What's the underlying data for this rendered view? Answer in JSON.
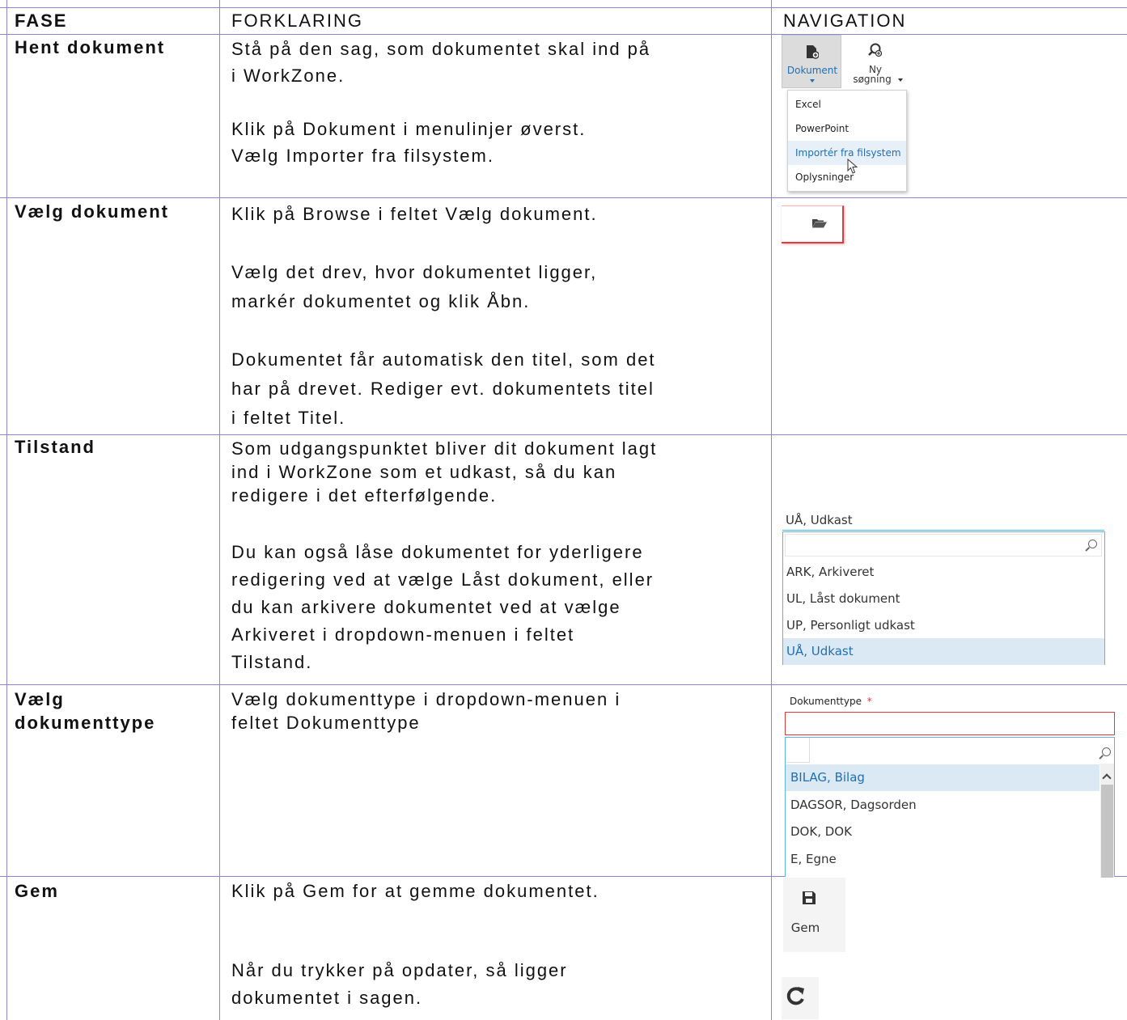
{
  "headers": {
    "fase": "FASE",
    "forklaring": "FORKLARING",
    "navigation": "NAVIGATION"
  },
  "rows": [
    {
      "fase": "Hent dokument",
      "text": [
        "Stå på den sag, som dokumentet skal ind på",
        "i WorkZone.",
        "",
        "Klik på Dokument i menulinjer øverst.",
        "Vælg Importer fra filsystem."
      ]
    },
    {
      "fase": "Vælg dokument",
      "text": [
        "Klik på Browse i feltet Vælg dokument.",
        "",
        "Vælg det drev, hvor dokumentet ligger,",
        "markér dokumentet og klik Åbn.",
        "",
        "Dokumentet får automatisk den titel, som det",
        "har på drevet. Rediger evt. dokumentets titel",
        "i feltet Titel."
      ]
    },
    {
      "fase": "Tilstand",
      "text_top": [
        "Som udgangspunktet bliver dit dokument lagt",
        "ind i WorkZone som et udkast, så du kan",
        "redigere i det efterfølgende."
      ],
      "text_bottom": [
        "Du kan også låse dokumentet for yderligere",
        "redigering ved at vælge Låst dokument, eller",
        "du kan arkivere dokumentet ved at vælge",
        "Arkiveret i dropdown-menuen i feltet",
        "Tilstand."
      ]
    },
    {
      "fase_lines": [
        "Vælg",
        "dokumenttype"
      ],
      "text": [
        "Vælg dokumenttype i dropdown-menuen i",
        "feltet Dokumenttype"
      ]
    },
    {
      "fase": "Gem",
      "text_top": [
        "Klik på Gem for at gemme dokumentet."
      ],
      "text_bottom": [
        "Når du trykker på opdater, så ligger",
        "dokumentet i sagen."
      ]
    }
  ],
  "nav": {
    "ribbon": {
      "dokument_label": "Dokument",
      "ny_label_1": "Ny",
      "ny_label_2": "søgning",
      "menu_items": [
        "Excel",
        "PowerPoint",
        "Importér fra filsystem",
        "Oplysninger"
      ],
      "highlighted_index": 2
    },
    "tilstand": {
      "current_value": "UÅ, Udkast",
      "options": [
        "ARK, Arkiveret",
        "UL, Låst dokument",
        "UP, Personligt udkast",
        "UÅ, Udkast"
      ],
      "selected_index": 3
    },
    "dokumenttype": {
      "label": "Dokumenttype",
      "required_mark": "*",
      "options": [
        "BILAG, Bilag",
        "DAGSOR, Dagsorden",
        "DOK, DOK",
        "E, Egne"
      ],
      "selected_index": 0
    },
    "gem_label": "Gem"
  },
  "colors": {
    "grid": "#8c85d6",
    "accent_blue": "#1f6fb5",
    "list_border": "#5bb6e6",
    "error_red": "#e0393e"
  }
}
